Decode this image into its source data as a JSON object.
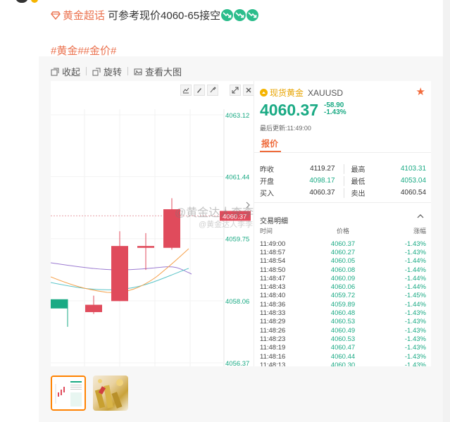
{
  "post": {
    "topic": "黄金超话",
    "text": "可参考现价4060-65接空",
    "hashtags": "#黄金##金价#"
  },
  "toolbar": {
    "collapse": "收起",
    "rotate": "旋转",
    "view_large": "查看大图"
  },
  "watermark": {
    "primary": "@黄金达人李李",
    "secondary": "@黄金达人李李"
  },
  "quote": {
    "name": "现货黄金",
    "code": "XAUUSD",
    "price": "4060.37",
    "change": "-58.90",
    "change_pct": "-1.43%",
    "updated": "最后更新:11:49:00",
    "tab": "报价",
    "stats": [
      {
        "l": "昨收",
        "v": "4119.27",
        "l2": "最高",
        "v2": "4103.31"
      },
      {
        "l": "开盘",
        "v": "4098.17",
        "l2": "最低",
        "v2": "4053.04"
      },
      {
        "l": "买入",
        "v": "4060.37",
        "l2": "卖出",
        "v2": "4060.54"
      }
    ],
    "ticks_title": "交易明细",
    "ticks_headers": {
      "time": "时间",
      "price": "价格",
      "change": "涨幅"
    },
    "ticks": [
      {
        "t": "11:49:00",
        "p": "4060.37",
        "c": "-1.43%"
      },
      {
        "t": "11:48:57",
        "p": "4060.27",
        "c": "-1.43%"
      },
      {
        "t": "11:48:54",
        "p": "4060.05",
        "c": "-1.44%"
      },
      {
        "t": "11:48:50",
        "p": "4060.08",
        "c": "-1.44%"
      },
      {
        "t": "11:48:47",
        "p": "4060.09",
        "c": "-1.44%"
      },
      {
        "t": "11:48:43",
        "p": "4060.06",
        "c": "-1.44%"
      },
      {
        "t": "11:48:40",
        "p": "4059.72",
        "c": "-1.45%"
      },
      {
        "t": "11:48:36",
        "p": "4059.89",
        "c": "-1.44%"
      },
      {
        "t": "11:48:33",
        "p": "4060.48",
        "c": "-1.43%"
      },
      {
        "t": "11:48:29",
        "p": "4060.53",
        "c": "-1.43%"
      },
      {
        "t": "11:48:26",
        "p": "4060.49",
        "c": "-1.43%"
      },
      {
        "t": "11:48:23",
        "p": "4060.53",
        "c": "-1.43%"
      },
      {
        "t": "11:48:19",
        "p": "4060.47",
        "c": "-1.43%"
      },
      {
        "t": "11:48:16",
        "p": "4060.44",
        "c": "-1.43%"
      },
      {
        "t": "11:48:13",
        "p": "4060.30",
        "c": "-1.43%"
      }
    ]
  },
  "chart": {
    "y_ticks": [
      "4063.12",
      "4061.44",
      "4059.75",
      "4058.06",
      "4056.37"
    ],
    "y_range": [
      4056.37,
      4063.12
    ],
    "current_label": "4060.37",
    "candles": [
      {
        "o": 4058.1,
        "h": 4058.1,
        "l": 4057.35,
        "c": 4057.85
      },
      {
        "o": 4057.95,
        "h": 4058.2,
        "l": 4057.7,
        "c": 4057.75
      },
      {
        "o": 4058.05,
        "h": 4059.95,
        "l": 4058.05,
        "c": 4059.55
      },
      {
        "o": 4059.55,
        "h": 4059.9,
        "l": 4058.9,
        "c": 4059.5
      },
      {
        "o": 4059.5,
        "h": 4060.85,
        "l": 4059.45,
        "c": 4060.55
      }
    ],
    "colors": {
      "up": "#e04b5c",
      "down": "#1aaa84",
      "ma_orange": "#f5a04a",
      "ma_teal": "#5bc4c8",
      "ma_purple": "#9b7ad1"
    }
  }
}
